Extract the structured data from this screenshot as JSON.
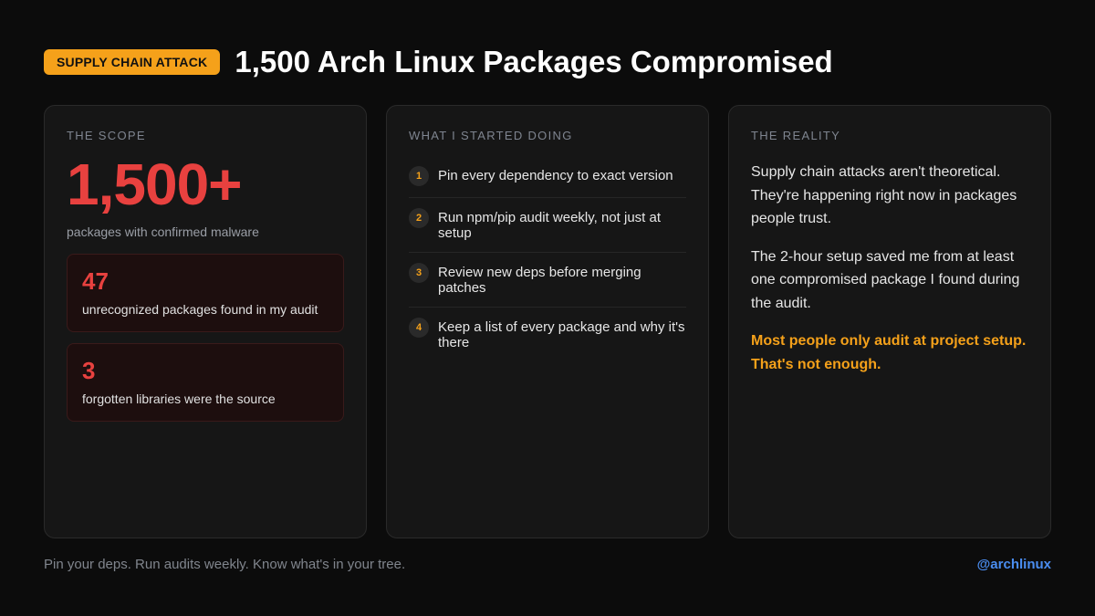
{
  "header": {
    "badge": "SUPPLY CHAIN ATTACK",
    "title": "1,500 Arch Linux Packages Compromised"
  },
  "scope": {
    "label": "THE SCOPE",
    "big_number": "1,500+",
    "big_caption": "packages with confirmed malware",
    "stats": [
      {
        "value": "47",
        "caption": "unrecognized packages found in my audit"
      },
      {
        "value": "3",
        "caption": "forgotten libraries were the source"
      }
    ]
  },
  "steps": {
    "label": "WHAT I STARTED DOING",
    "items": [
      {
        "num": "1",
        "text": "Pin every dependency to exact version"
      },
      {
        "num": "2",
        "text": "Run npm/pip audit weekly, not just at setup"
      },
      {
        "num": "3",
        "text": "Review new deps before merging patches"
      },
      {
        "num": "4",
        "text": "Keep a list of every package and why it's there"
      }
    ]
  },
  "reality": {
    "label": "THE REALITY",
    "paragraphs": [
      "Supply chain attacks aren't theoretical. They're happening right now in packages people trust.",
      "The 2-hour setup saved me from at least one compromised package I found during the audit."
    ],
    "highlight": "Most people only audit at project setup. That's not enough."
  },
  "footer": {
    "tagline": "Pin your deps. Run audits weekly. Know what's in your tree.",
    "handle": "@archlinux"
  },
  "colors": {
    "accent": "#f5a11a",
    "danger": "#e8413f",
    "link": "#4a8df0",
    "background": "#0c0c0c"
  }
}
